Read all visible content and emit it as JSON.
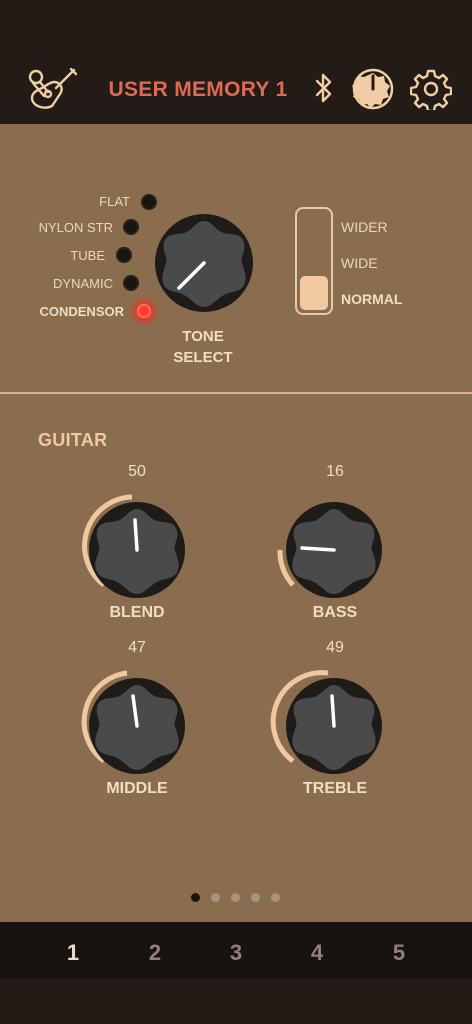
{
  "header": {
    "title": "USER MEMORY 1",
    "icons": [
      "guitar-mic-icon",
      "bluetooth-icon",
      "knob-icon",
      "gear-icon"
    ],
    "accent_color": "#de6a55"
  },
  "tone_select": {
    "label_line1": "TONE",
    "label_line2": "SELECT",
    "options": [
      {
        "label": "FLAT",
        "active": false
      },
      {
        "label": "NYLON STR",
        "active": false
      },
      {
        "label": "TUBE",
        "active": false
      },
      {
        "label": "DYNAMIC",
        "active": false
      },
      {
        "label": "CONDENSOR",
        "active": true
      }
    ],
    "selected": "CONDENSOR"
  },
  "width_switch": {
    "options": [
      "WIDER",
      "WIDE",
      "NORMAL"
    ],
    "selected": "NORMAL"
  },
  "guitar": {
    "section_label": "GUITAR",
    "knobs": [
      {
        "label": "BLEND",
        "value": "50"
      },
      {
        "label": "BASS",
        "value": "16"
      },
      {
        "label": "MIDDLE",
        "value": "47"
      },
      {
        "label": "TREBLE",
        "value": "49"
      }
    ]
  },
  "pager": {
    "count": 5,
    "active_index": 0
  },
  "tabs": [
    {
      "label": "1",
      "active": true
    },
    {
      "label": "2",
      "active": false
    },
    {
      "label": "3",
      "active": false
    },
    {
      "label": "4",
      "active": false
    },
    {
      "label": "5",
      "active": false
    }
  ]
}
